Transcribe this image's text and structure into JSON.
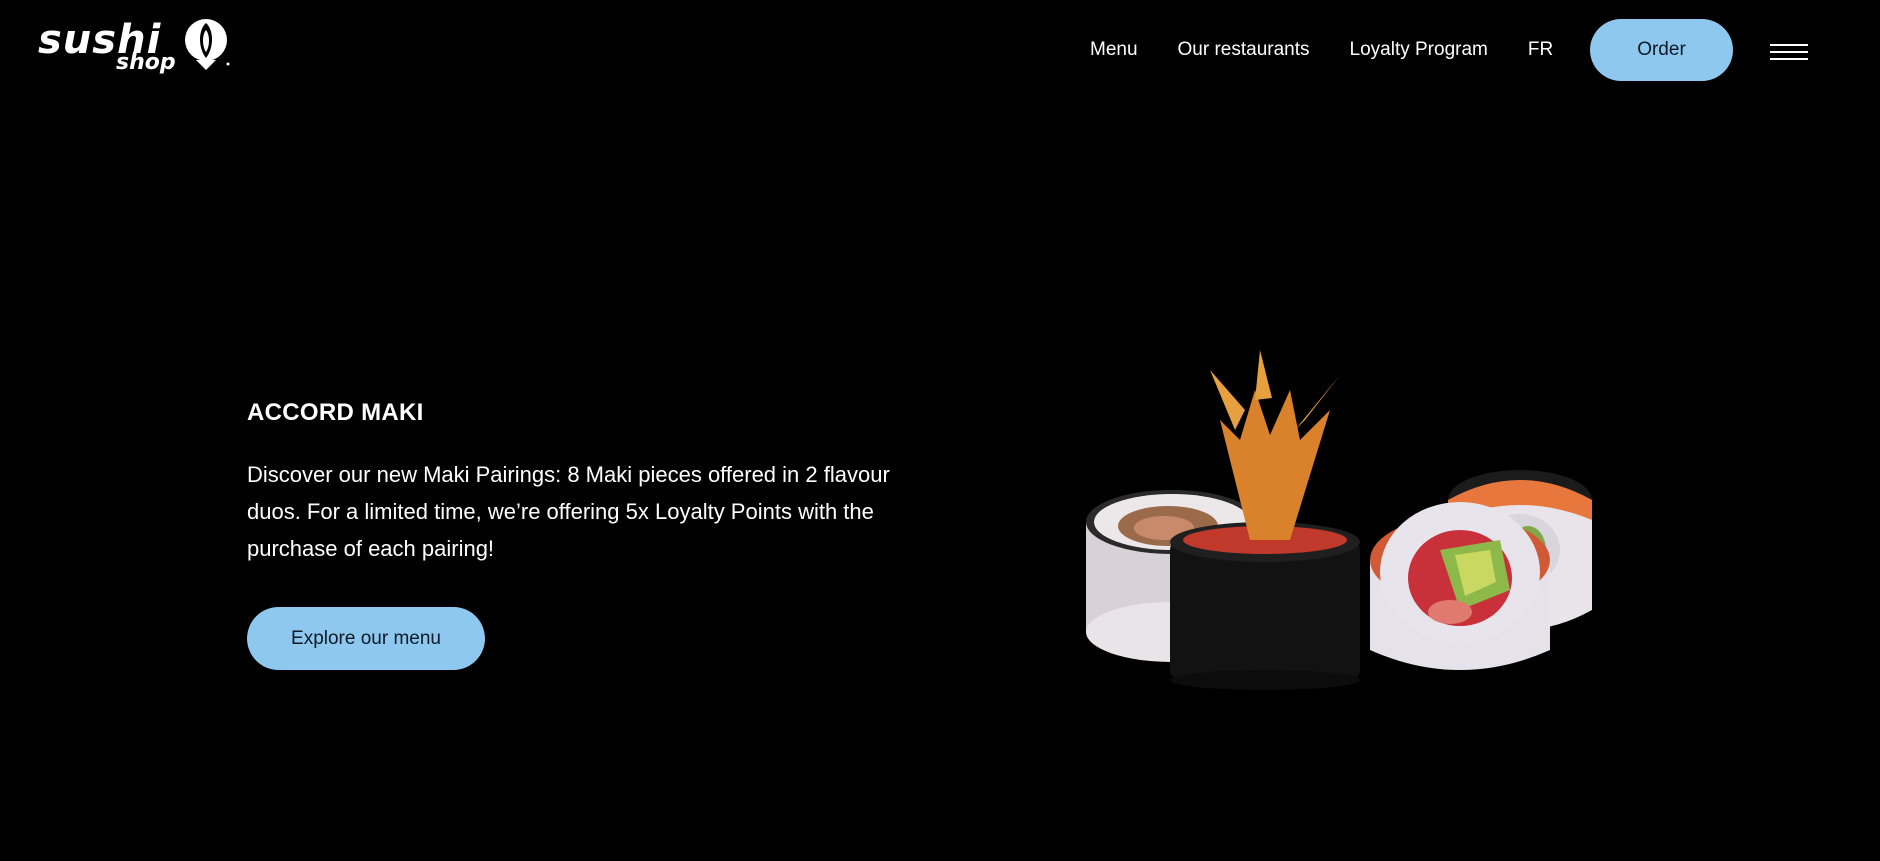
{
  "header": {
    "logo": {
      "wordmark": "sushi",
      "sub": "shop"
    },
    "nav": [
      {
        "label": "Menu"
      },
      {
        "label": "Our restaurants"
      },
      {
        "label": "Loyalty Program"
      },
      {
        "label": "FR"
      }
    ],
    "order_label": "Order",
    "menu_icon": "hamburger-icon"
  },
  "hero": {
    "title": "ACCORD MAKI",
    "description": "Discover our new Maki Pairings: 8 Maki pieces offered in 2 flavour duos. For a limited time, we’re offering 5x Loyalty Points with the purchase of each pairing!",
    "cta_label": "Explore our menu",
    "image": "sushi-maki-image"
  },
  "colors": {
    "background": "#000000",
    "accent": "#8ec8ee",
    "text": "#ffffff",
    "button_text": "#0b1a26"
  }
}
